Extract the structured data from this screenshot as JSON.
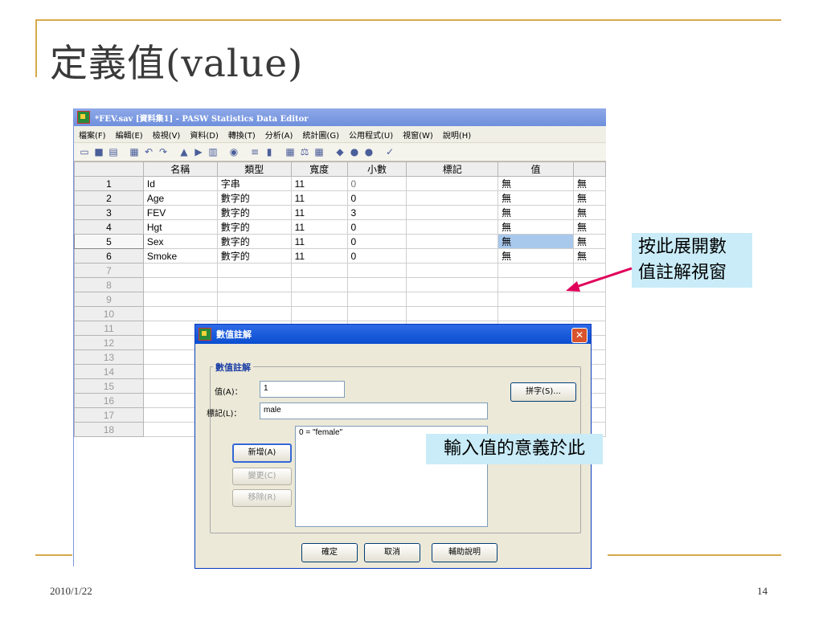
{
  "slide": {
    "title": "定義值(value)",
    "date": "2010/1/22",
    "page": "14"
  },
  "app": {
    "title": "*FEV.sav [資料集1] - PASW Statistics Data Editor",
    "menus": [
      "檔案(F)",
      "編輯(E)",
      "檢視(V)",
      "資料(D)",
      "轉換(T)",
      "分析(A)",
      "統計圖(G)",
      "公用程式(U)",
      "視窗(W)",
      "說明(H)"
    ]
  },
  "grid": {
    "headers": [
      "",
      "名稱",
      "類型",
      "寬度",
      "小數",
      "標記",
      "值",
      ""
    ],
    "rows": [
      {
        "num": "1",
        "name": "Id",
        "type": "字串",
        "width": "11",
        "decimals": "0",
        "label": "",
        "values": "無",
        "missing": "無"
      },
      {
        "num": "2",
        "name": "Age",
        "type": "數字的",
        "width": "11",
        "decimals": "0",
        "label": "",
        "values": "無",
        "missing": "無"
      },
      {
        "num": "3",
        "name": "FEV",
        "type": "數字的",
        "width": "11",
        "decimals": "3",
        "label": "",
        "values": "無",
        "missing": "無"
      },
      {
        "num": "4",
        "name": "Hgt",
        "type": "數字的",
        "width": "11",
        "decimals": "0",
        "label": "",
        "values": "無",
        "missing": "無"
      },
      {
        "num": "5",
        "name": "Sex",
        "type": "數字的",
        "width": "11",
        "decimals": "0",
        "label": "",
        "values": "無",
        "missing": "無"
      },
      {
        "num": "6",
        "name": "Smoke",
        "type": "數字的",
        "width": "11",
        "decimals": "0",
        "label": "",
        "values": "無",
        "missing": "無"
      }
    ],
    "empty_rows": [
      "7",
      "8",
      "9",
      "10",
      "11",
      "12",
      "13",
      "14",
      "15",
      "16",
      "17",
      "18"
    ]
  },
  "dialog": {
    "title": "數值註解",
    "close": "✕",
    "group_label": "數值註解",
    "value_label": "值(A)：",
    "value_input": "1",
    "label_label": "標記(L)：",
    "label_input": "male",
    "spell_button": "拼字(S)...",
    "list_items": [
      "0 = \"female\""
    ],
    "add_button": "新增(A)",
    "change_button": "變更(C)",
    "remove_button": "移除(R)",
    "ok_button": "確定",
    "cancel_button": "取消",
    "help_button": "輔助說明"
  },
  "callouts": {
    "expand_line1": "按此展開數",
    "expand_line2": "值註解視窗",
    "input_meaning": "輸入值的意義於此"
  },
  "colors": {
    "accent_line": "#d6a94a",
    "callout_bg": "#c9ecf8",
    "arrow": "#e0005a",
    "selected_cell": "#a8c8ec"
  }
}
